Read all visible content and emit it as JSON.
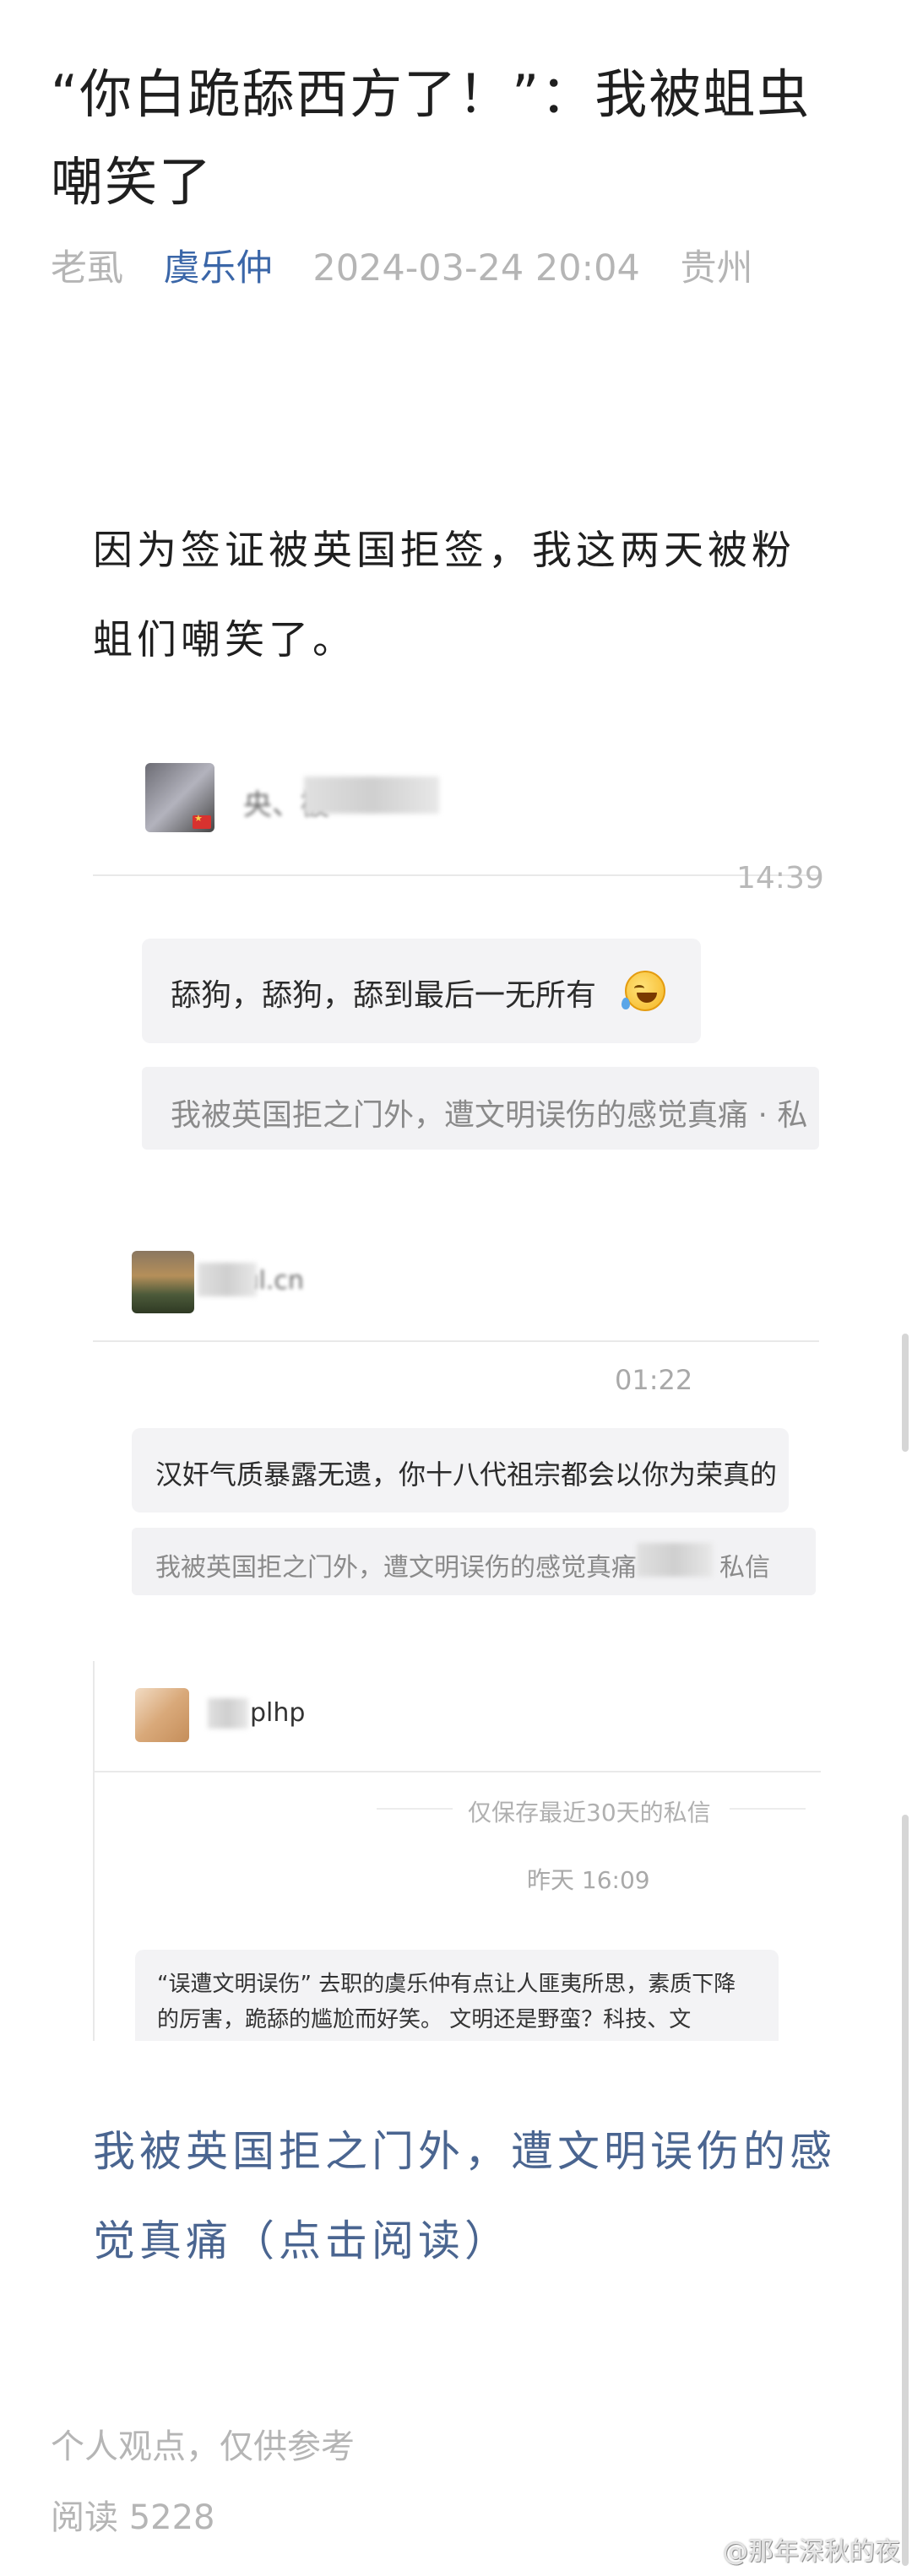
{
  "article": {
    "title": "“你白跪舔西方了！”：我被蛆虫嘲笑了",
    "meta": {
      "source": "老虱",
      "author": "虞乐仲",
      "datetime": "2024-03-24 20:04",
      "location": "贵州"
    },
    "intro": "因为签证被英国拒签，我这两天被粉蛆们嘲笑了。",
    "link_text": "我被英国拒之门外，遭文明误伤的感觉真痛（点击阅读）",
    "footer_note": "个人观点，仅供参考",
    "read_count_label": "阅读 5228"
  },
  "screenshots": {
    "shot1": {
      "username_partial": "央、被",
      "time": "14:39",
      "message": "舔狗，舔狗，舔到最后一无所有",
      "quote": "我被英国拒之门外，遭文明误伤的感觉真痛 · 私"
    },
    "shot2": {
      "username_partial": "‧ul.cn",
      "time": "01:22",
      "message": "汉奸气质暴露无遗，你十八代祖宗都会以你为荣真的",
      "quote_prefix": "我被英国拒之门外，遭文明误伤的感觉真痛 ·",
      "quote_suffix": "私信"
    },
    "shot3": {
      "username_partial": "plhp",
      "notice": "仅保存最近30天的私信",
      "time": "昨天 16:09",
      "message_line1": "“误遭文明误伤” 去职的虞乐仲有点让人匪夷所思，素质下降",
      "message_line2": "的厉害，跪舔的尴尬而好笑。 文明还是野蛮？科技、文"
    }
  },
  "watermark": "@那年深秋的夜",
  "colors": {
    "author_blue": "#3a66a8",
    "link_blue": "#4a6590",
    "meta_gray": "#b5b5b5"
  }
}
